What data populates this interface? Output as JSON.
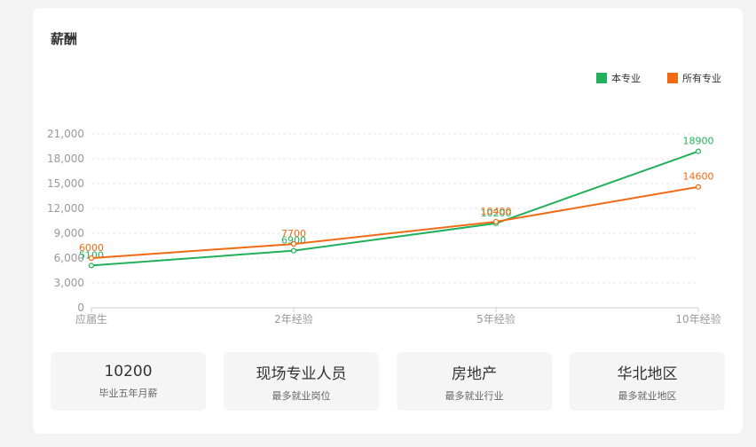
{
  "section": {
    "title": "薪酬"
  },
  "legend": [
    {
      "label": "本专业",
      "color": "#22b05a"
    },
    {
      "label": "所有专业",
      "color": "#f06a14"
    }
  ],
  "chart_data": {
    "type": "line",
    "categories": [
      "应届生",
      "2年经验",
      "5年经验",
      "10年经验"
    ],
    "series": [
      {
        "name": "本专业",
        "values": [
          5100,
          6900,
          10200,
          18900
        ],
        "color": "#22b05a"
      },
      {
        "name": "所有专业",
        "values": [
          6000,
          7700,
          10400,
          14600
        ],
        "color": "#f06a14"
      }
    ],
    "yticks": [
      "0",
      "3,000",
      "6,000",
      "9,000",
      "12,000",
      "15,000",
      "18,000",
      "21,000"
    ],
    "ylim": [
      0,
      21000
    ],
    "grid": true,
    "legend_position": "top-right"
  },
  "stats": [
    {
      "value": "10200",
      "label": "毕业五年月薪"
    },
    {
      "value": "现场专业人员",
      "label": "最多就业岗位"
    },
    {
      "value": "房地产",
      "label": "最多就业行业"
    },
    {
      "value": "华北地区",
      "label": "最多就业地区"
    }
  ]
}
